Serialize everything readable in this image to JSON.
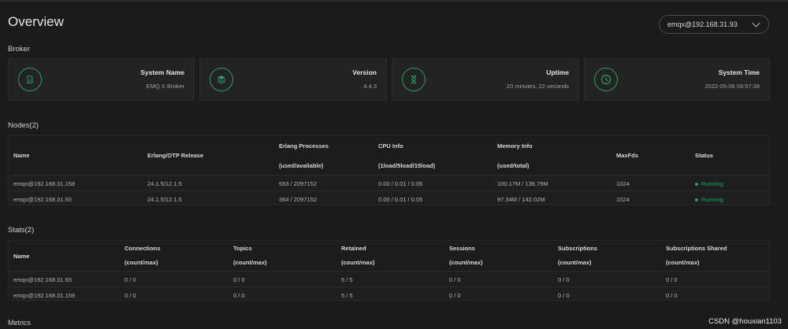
{
  "header": {
    "title": "Overview",
    "node_select": "emqx@192.168.31.93"
  },
  "broker": {
    "label": "Broker",
    "cards": [
      {
        "label": "System Name",
        "value": "EMQ X Broker",
        "icon": "document-icon"
      },
      {
        "label": "Version",
        "value": "4.4.3",
        "icon": "layers-icon"
      },
      {
        "label": "Uptime",
        "value": "20 minutes, 22 seconds",
        "icon": "hourglass-icon"
      },
      {
        "label": "System Time",
        "value": "2022-05-06 09:57:38",
        "icon": "clock-icon"
      }
    ]
  },
  "nodes": {
    "label": "Nodes(2)",
    "columns": {
      "name": "Name",
      "erlang": "Erlang/OTP Release",
      "processes": "Erlang Processes",
      "processes_sub": "(used/avaliable)",
      "cpu": "CPU Info",
      "cpu_sub": "(1load/5load/15load)",
      "memory": "Memory Info",
      "memory_sub": "(used/total)",
      "maxfds": "MaxFds",
      "status": "Status"
    },
    "rows": [
      {
        "name": "emqx@192.168.31.159",
        "erlang": "24.1.5/12.1.5",
        "processes": "593 / 2097152",
        "cpu": "0.00 / 0.01 / 0.05",
        "memory": "100.17M / 136.79M",
        "maxfds": "1024",
        "status": "Running"
      },
      {
        "name": "emqx@192.168.31.93",
        "erlang": "24.1.5/12.1.5",
        "processes": "364 / 2097152",
        "cpu": "0.00 / 0.01 / 0.05",
        "memory": "97.34M / 142.02M",
        "maxfds": "1024",
        "status": "Running"
      }
    ]
  },
  "stats": {
    "label": "Stats(2)",
    "columns": {
      "name": "Name",
      "connections": "Connections",
      "topics": "Topics",
      "retained": "Retained",
      "sessions": "Sessions",
      "subscriptions": "Subscriptions",
      "subscriptions_shared": "Subscriptions Shared",
      "sub": "(count/max)"
    },
    "rows": [
      {
        "name": "emqx@192.168.31.93",
        "connections": "0 / 0",
        "topics": "0 / 0",
        "retained": "5 / 5",
        "sessions": "0 / 0",
        "subscriptions": "0 / 0",
        "subscriptions_shared": "0 / 0"
      },
      {
        "name": "emqx@192.168.31.159",
        "connections": "0 / 0",
        "topics": "0 / 0",
        "retained": "5 / 5",
        "sessions": "0 / 0",
        "subscriptions": "0 / 0",
        "subscriptions_shared": "0 / 0"
      }
    ]
  },
  "metrics": {
    "label": "Metrics"
  },
  "watermark": "CSDN @houxian1103",
  "colors": {
    "accent": "#2b9b63",
    "background": "#1b1b1c",
    "card": "#232324"
  }
}
